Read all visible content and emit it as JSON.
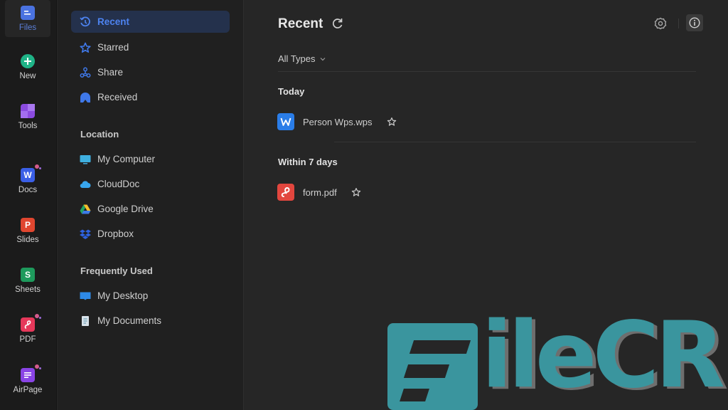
{
  "rail": {
    "items": [
      {
        "label": "Files",
        "icon": "files-icon",
        "color": "#4a72e0",
        "active": true
      },
      {
        "label": "New",
        "icon": "plus-circle-icon",
        "color": "#1fb387"
      },
      {
        "label": "Tools",
        "icon": "tools-grid-icon",
        "color": "#8b4be0"
      },
      {
        "label": "Docs",
        "icon": "docs-icon",
        "glyph": "W",
        "color": "#3a5fe6"
      },
      {
        "label": "Slides",
        "icon": "slides-icon",
        "glyph": "P",
        "color": "#e0462f"
      },
      {
        "label": "Sheets",
        "icon": "sheets-icon",
        "glyph": "S",
        "color": "#1e9a5c"
      },
      {
        "label": "PDF",
        "icon": "pdf-icon",
        "color": "#e6385a"
      },
      {
        "label": "AirPage",
        "icon": "airpage-icon",
        "color": "#8a44e6"
      }
    ]
  },
  "nav": {
    "items": [
      {
        "label": "Recent",
        "icon": "clock-history-icon",
        "active": true
      },
      {
        "label": "Starred",
        "icon": "star-icon"
      },
      {
        "label": "Share",
        "icon": "share-icon"
      },
      {
        "label": "Received",
        "icon": "received-icon"
      }
    ],
    "location_title": "Location",
    "locations": [
      {
        "label": "My Computer",
        "icon": "monitor-icon"
      },
      {
        "label": "CloudDoc",
        "icon": "cloud-icon"
      },
      {
        "label": "Google Drive",
        "icon": "google-drive-icon"
      },
      {
        "label": "Dropbox",
        "icon": "dropbox-icon"
      }
    ],
    "frequent_title": "Frequently Used",
    "frequent": [
      {
        "label": "My Desktop",
        "icon": "desktop-folder-icon"
      },
      {
        "label": "My Documents",
        "icon": "documents-icon"
      }
    ]
  },
  "main": {
    "title": "Recent",
    "filter": "All Types",
    "groups": [
      {
        "title": "Today",
        "files": [
          {
            "name": "Person Wps.wps",
            "type": "wps",
            "color": "#2a7de8"
          }
        ]
      },
      {
        "title": "Within 7 days",
        "files": [
          {
            "name": "form.pdf",
            "type": "pdf",
            "color": "#e2463e"
          }
        ]
      }
    ]
  },
  "watermark": {
    "text": "ileCR",
    "color": "#3a959e"
  }
}
